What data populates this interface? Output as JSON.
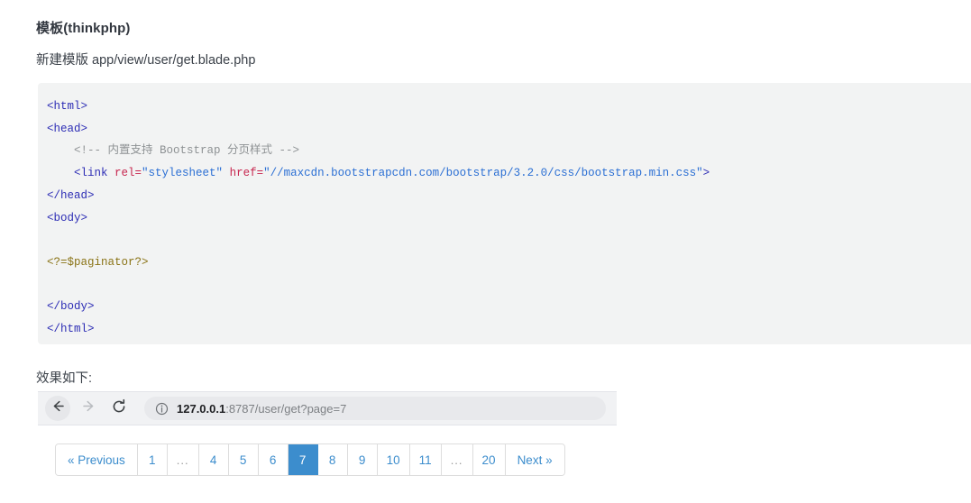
{
  "doc": {
    "heading": "模板(thinkphp)",
    "subline": "新建模版 app/view/user/get.blade.php",
    "effect_label": "效果如下:"
  },
  "code": {
    "language": "html",
    "background": "#f2f3f3",
    "colors": {
      "tag": "#2d2db5",
      "attribute": "#c7254e",
      "string": "#2b6fd4",
      "comment": "#8e9294",
      "php": "#8a7316"
    },
    "lines": [
      [
        {
          "t": "tag",
          "v": "<html>"
        }
      ],
      [
        {
          "t": "tag",
          "v": "<head>"
        }
      ],
      [
        {
          "t": "comment",
          "v": "    <!-- 内置支持 Bootstrap 分页样式 -->"
        }
      ],
      [
        {
          "t": "tag",
          "v": "    <link "
        },
        {
          "t": "attr",
          "v": "rel="
        },
        {
          "t": "string",
          "v": "\"stylesheet\""
        },
        {
          "t": "tag",
          "v": " "
        },
        {
          "t": "attr",
          "v": "href="
        },
        {
          "t": "string",
          "v": "\"//maxcdn.bootstrapcdn.com/bootstrap/3.2.0/css/bootstrap.min.css\""
        },
        {
          "t": "tag",
          "v": ">"
        }
      ],
      [
        {
          "t": "tag",
          "v": "</head>"
        }
      ],
      [
        {
          "t": "tag",
          "v": "<body>"
        }
      ],
      [
        {
          "t": "plain",
          "v": ""
        }
      ],
      [
        {
          "t": "php",
          "v": "<?=$paginator?>"
        }
      ],
      [
        {
          "t": "plain",
          "v": ""
        }
      ],
      [
        {
          "t": "tag",
          "v": "</body>"
        }
      ],
      [
        {
          "t": "tag",
          "v": "</html>"
        }
      ]
    ]
  },
  "browser": {
    "back_icon": "arrow-left-icon",
    "forward_icon": "arrow-right-icon",
    "reload_icon": "reload-icon",
    "info_icon": "info-circle-icon",
    "url_host": "127.0.0.1",
    "url_rest": ":8787/user/get?page=7"
  },
  "pagination": {
    "active_color": "#3c8dcd",
    "items": [
      {
        "label": "« Previous",
        "active": false,
        "dots": false,
        "wide": true
      },
      {
        "label": "1",
        "active": false,
        "dots": false,
        "wide": false
      },
      {
        "label": "...",
        "active": false,
        "dots": true,
        "wide": false
      },
      {
        "label": "4",
        "active": false,
        "dots": false,
        "wide": false
      },
      {
        "label": "5",
        "active": false,
        "dots": false,
        "wide": false
      },
      {
        "label": "6",
        "active": false,
        "dots": false,
        "wide": false
      },
      {
        "label": "7",
        "active": true,
        "dots": false,
        "wide": false
      },
      {
        "label": "8",
        "active": false,
        "dots": false,
        "wide": false
      },
      {
        "label": "9",
        "active": false,
        "dots": false,
        "wide": false
      },
      {
        "label": "10",
        "active": false,
        "dots": false,
        "wide": false
      },
      {
        "label": "11",
        "active": false,
        "dots": false,
        "wide": false
      },
      {
        "label": "...",
        "active": false,
        "dots": true,
        "wide": false
      },
      {
        "label": "20",
        "active": false,
        "dots": false,
        "wide": false
      },
      {
        "label": "Next »",
        "active": false,
        "dots": false,
        "wide": true
      }
    ]
  }
}
